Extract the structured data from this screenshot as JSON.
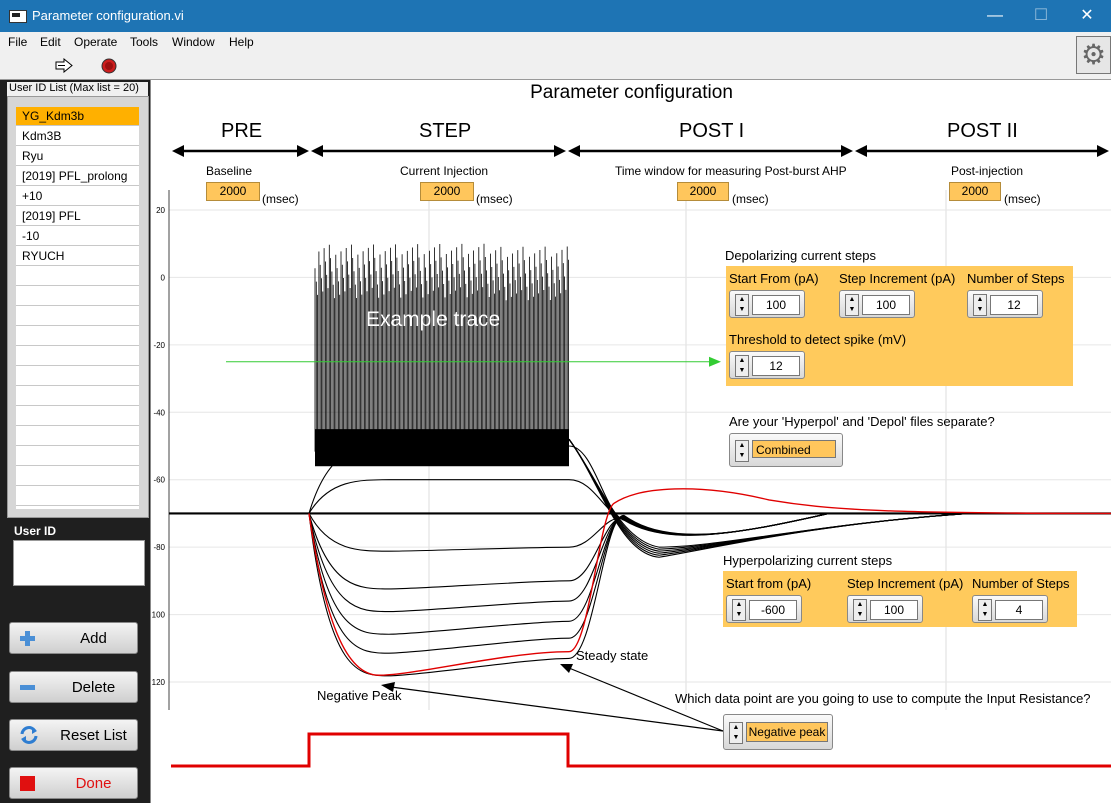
{
  "window": {
    "title": "Parameter configuration.vi",
    "minimize": "—",
    "maximize": "☐",
    "close": "✕"
  },
  "menu": [
    "File",
    "Edit",
    "Operate",
    "Tools",
    "Window",
    "Help"
  ],
  "left_panel": {
    "list_title": "User ID List (Max list = 20)",
    "items": [
      "YG_Kdm3b",
      "Kdm3B",
      "Ryu",
      "[2019] PFL_prolong",
      "+10",
      "[2019] PFL",
      "-10",
      "RYUCH",
      "",
      "",
      "",
      "",
      "",
      "",
      "",
      "",
      "",
      "",
      "",
      ""
    ],
    "selected_index": 0,
    "user_id_label": "User ID",
    "user_id_value": "",
    "buttons": {
      "add": "Add",
      "delete": "Delete",
      "reset": "Reset List",
      "done": "Done"
    }
  },
  "main": {
    "title": "Parameter configuration",
    "phases": [
      {
        "name": "PRE",
        "sub": "Baseline",
        "value": "2000",
        "unit": "(msec)"
      },
      {
        "name": "STEP",
        "sub": "Current Injection",
        "value": "2000",
        "unit": "(msec)"
      },
      {
        "name": "POST I",
        "sub": "Time window for measuring Post-burst AHP",
        "value": "2000",
        "unit": "(msec)"
      },
      {
        "name": "POST II",
        "sub": "Post-injection",
        "value": "2000",
        "unit": "(msec)"
      }
    ],
    "example_trace_label": "Example trace",
    "steady_state_label": "Steady state",
    "negative_peak_label": "Negative Peak",
    "depol": {
      "title": "Depolarizing current steps",
      "start_label": "Start From (pA)",
      "start_value": "100",
      "increment_label": "Step Increment (pA)",
      "increment_value": "100",
      "steps_label": "Number of Steps",
      "steps_value": "12",
      "threshold_label": "Threshold to detect spike (mV)",
      "threshold_value": "12"
    },
    "separate_question": "Are your 'Hyperpol' and 'Depol' files separate?",
    "separate_value": "Combined",
    "hyperpol": {
      "title": "Hyperpolarizing current steps",
      "start_label": "Start from (pA)",
      "start_value": "-600",
      "increment_label": "Step Increment (pA)",
      "increment_value": "100",
      "steps_label": "Number of Steps",
      "steps_value": "4"
    },
    "input_res_question": "Which data point are you going to use to compute the Input Resistance?",
    "input_res_value": "Negative peak"
  },
  "chart_data": {
    "type": "line",
    "yticks": [
      "20",
      "0",
      "-20",
      "-40",
      "-60",
      "-80",
      "100",
      "120"
    ],
    "ylim": [
      -120,
      20
    ],
    "baseline": -70,
    "step_levels": [
      -50,
      -60,
      -80,
      -90,
      -96,
      -102,
      -107,
      -113
    ],
    "negative_peak": -118,
    "steady_state": -111,
    "colors": {
      "trace": "#000000",
      "highlight": "#e00000",
      "arrow_green": "#33cc33"
    }
  }
}
